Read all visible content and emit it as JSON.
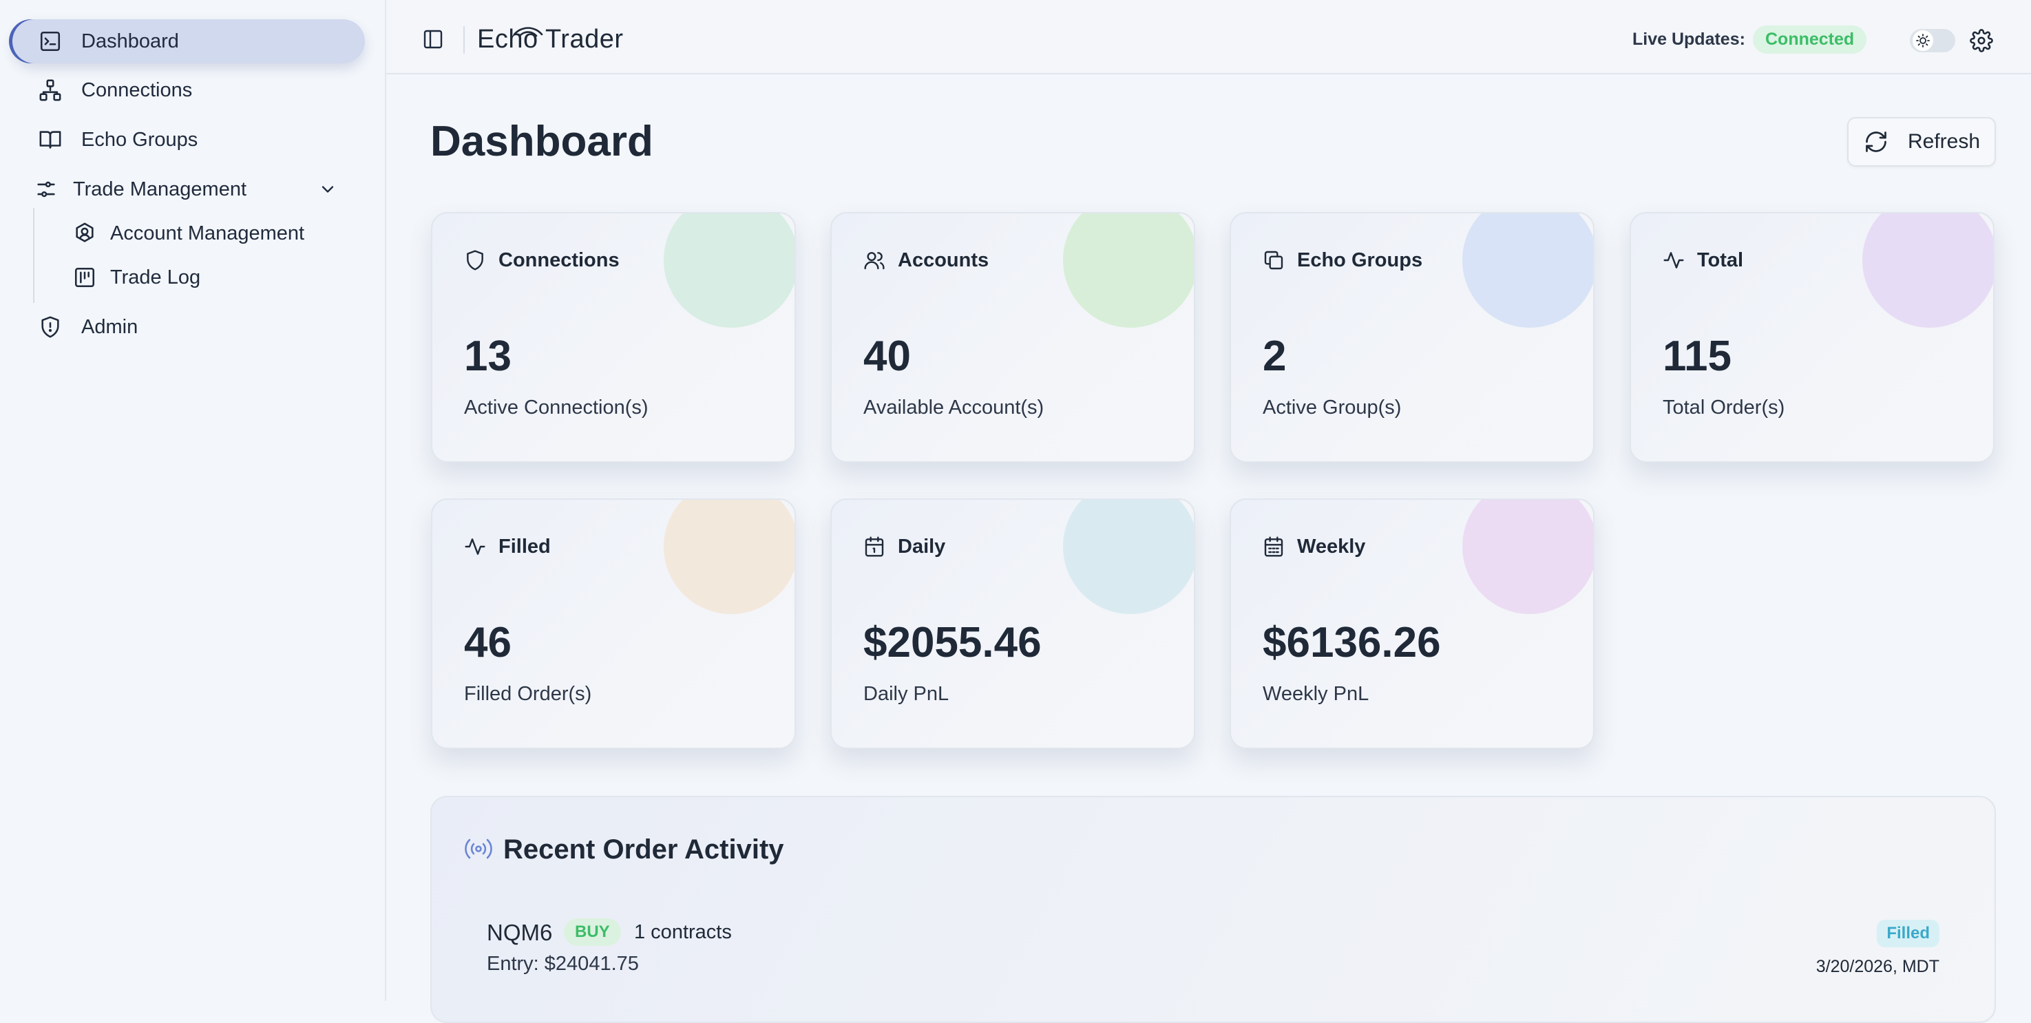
{
  "app": {
    "brand": "Echo Trader"
  },
  "sidebar": {
    "items": [
      {
        "label": "Dashboard",
        "icon": "dashboard-icon",
        "active": true
      },
      {
        "label": "Connections",
        "icon": "network-icon"
      },
      {
        "label": "Echo Groups",
        "icon": "book-icon"
      },
      {
        "label": "Trade Management",
        "icon": "sliders-icon",
        "expanded": true
      },
      {
        "label": "Account Management",
        "icon": "user-shield-icon",
        "sub": true
      },
      {
        "label": "Trade Log",
        "icon": "log-icon",
        "sub": true
      },
      {
        "label": "Admin",
        "icon": "shield-icon"
      }
    ]
  },
  "header": {
    "live_label": "Live Updates:",
    "live_status": "Connected"
  },
  "page": {
    "title": "Dashboard",
    "refresh_label": "Refresh"
  },
  "stats": [
    {
      "title": "Connections",
      "value": "13",
      "subtitle": "Active Connection(s)",
      "icon": "shield-icon",
      "color": "#d8ede3"
    },
    {
      "title": "Accounts",
      "value": "40",
      "subtitle": "Available Account(s)",
      "icon": "users-icon",
      "color": "#d8eed8"
    },
    {
      "title": "Echo Groups",
      "value": "2",
      "subtitle": "Active Group(s)",
      "icon": "copy-icon",
      "color": "#d9e3f7"
    },
    {
      "title": "Total",
      "value": "115",
      "subtitle": "Total Order(s)",
      "icon": "activity-icon",
      "color": "#e7dcf5"
    },
    {
      "title": "Filled",
      "value": "46",
      "subtitle": "Filled Order(s)",
      "icon": "activity-icon",
      "color": "#f3e8dc"
    },
    {
      "title": "Daily",
      "value": "$2055.46",
      "subtitle": "Daily PnL",
      "icon": "calendar-icon",
      "color": "#d9ebf1"
    },
    {
      "title": "Weekly",
      "value": "$6136.26",
      "subtitle": "Weekly PnL",
      "icon": "calendar-grid-icon",
      "color": "#ecdcf3"
    }
  ],
  "recent": {
    "title": "Recent Order Activity",
    "orders": [
      {
        "symbol": "NQM6",
        "side": "BUY",
        "qty": "1 contracts",
        "entry": "Entry: $24041.75",
        "status": "Filled",
        "date": "3/20/2026, MDT"
      }
    ]
  },
  "colors": {
    "accent": "#4b63b8",
    "success": "#3cbd68",
    "info": "#3aa9c9"
  }
}
